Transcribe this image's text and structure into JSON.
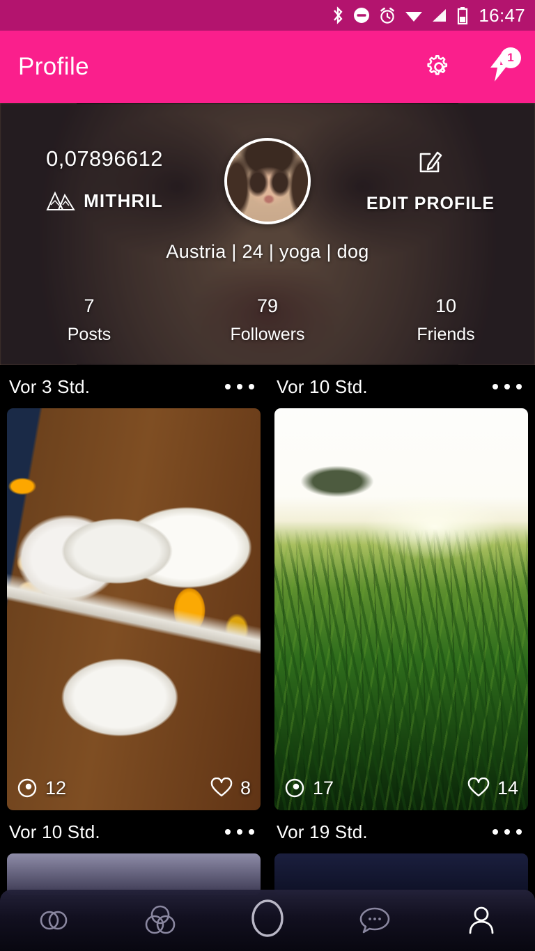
{
  "status_bar": {
    "time": "16:47",
    "icons": [
      "bluetooth-icon",
      "do-not-disturb-icon",
      "alarm-icon",
      "wifi-icon",
      "cell-signal-icon",
      "battery-icon"
    ],
    "background_color": "#B3146E"
  },
  "app_bar": {
    "title": "Profile",
    "background_color": "#FA1F8C",
    "settings_label": "Settings",
    "notifications_badge": "1"
  },
  "profile": {
    "token_amount": "0,07896612",
    "token_name": "MITHRIL",
    "edit_profile_label": "EDIT PROFILE",
    "bio": "Austria | 24 | yoga | dog",
    "stats": [
      {
        "value": "7",
        "label": "Posts"
      },
      {
        "value": "79",
        "label": "Followers"
      },
      {
        "value": "10",
        "label": "Friends"
      }
    ]
  },
  "feed": {
    "posts": [
      {
        "time": "Vor 3 Std.",
        "views": "12",
        "likes": "8",
        "image": "breakfast-table-photo"
      },
      {
        "time": "Vor 10 Std.",
        "views": "17",
        "likes": "14",
        "image": "sunset-grass-field-photo"
      },
      {
        "time": "Vor 10 Std.",
        "views": "",
        "likes": "",
        "image": "post-photo"
      },
      {
        "time": "Vor 19 Std.",
        "views": "",
        "likes": "",
        "image": "post-photo"
      }
    ]
  },
  "bottom_nav": {
    "items": [
      {
        "name": "two-circles-icon",
        "label": "Feed",
        "active": false
      },
      {
        "name": "venn-circles-icon",
        "label": "Discover",
        "active": false
      },
      {
        "name": "circle-camera-icon",
        "label": "Camera",
        "active": false
      },
      {
        "name": "chat-bubble-icon",
        "label": "Chat",
        "active": false
      },
      {
        "name": "person-icon",
        "label": "Profile",
        "active": true
      }
    ]
  },
  "colors": {
    "status_bar": "#B3146E",
    "accent_pink": "#FA1F8C",
    "feed_background": "#000000",
    "nav_background": "#14122a"
  }
}
